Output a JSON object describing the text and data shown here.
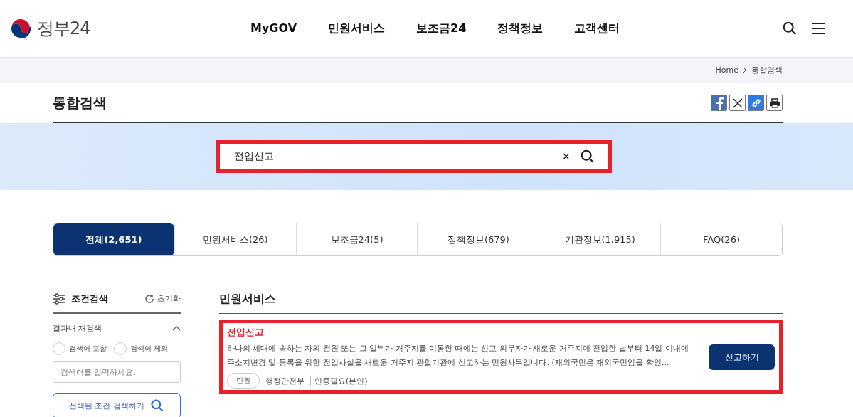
{
  "header": {
    "logo_text": "정부24",
    "nav": [
      {
        "label": "MyGOV"
      },
      {
        "label": "민원서비스"
      },
      {
        "label": "보조금24"
      },
      {
        "label": "정책정보"
      },
      {
        "label": "고객센터"
      }
    ]
  },
  "breadcrumb": [
    "Home",
    "통합검색"
  ],
  "page_title": "통합검색",
  "search": {
    "value": "전입신고",
    "clear": "×",
    "highlighted": true
  },
  "tabs": [
    {
      "label": "전체(2,651)",
      "selected": true
    },
    {
      "label": "민원서비스(26)",
      "selected": false
    },
    {
      "label": "보조금24(5)",
      "selected": false
    },
    {
      "label": "정책정보(679)",
      "selected": false
    },
    {
      "label": "기관정보(1,915)",
      "selected": false
    },
    {
      "label": "FAQ(26)",
      "selected": false
    }
  ],
  "sidebar": {
    "title": "조건검색",
    "reset": "초기화",
    "section": "결과내 재검색",
    "expanded": true,
    "options": [
      {
        "label": "검색어 포함",
        "selected": false
      },
      {
        "label": "검색어 제외",
        "selected": false
      }
    ],
    "placeholder": "검색어를 입력하세요.",
    "submit": "선택된 조건 검색하기"
  },
  "results": {
    "heading": "민원서비스",
    "items": [
      {
        "title": "전입신고",
        "description": "하나의 세대에 속하는 자의 전원 또는 그 일부가 거주지를 이동한 때에는 신고 의무자가 새로운 거주지에 전입한 날부터 14일 이내에 주소지변경 및 등록을 위한 전입사실을 새로운 거주지 관할기관에 신고하는 민원사무입니다. (재외국민은 재외국민임을 확인…",
        "tag": "민원",
        "agency": "행정안전부",
        "auth": "인증필요(본인)",
        "action": "신고하기",
        "highlighted": true
      }
    ]
  }
}
